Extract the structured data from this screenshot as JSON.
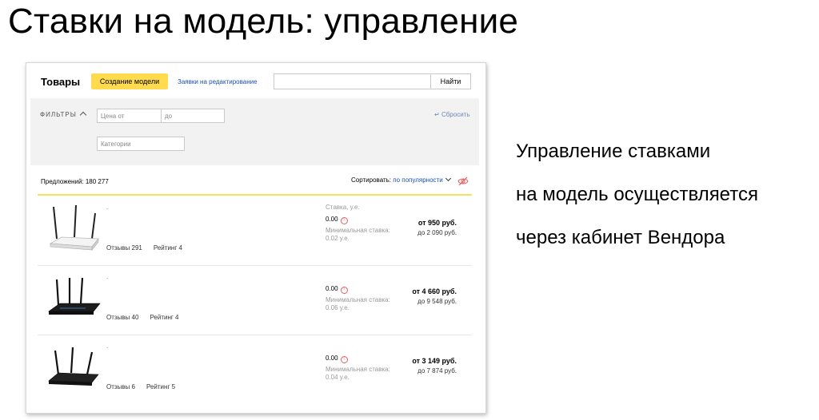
{
  "slide": {
    "title": "Ставки на модель: управление",
    "description": [
      "Управление ставками",
      "на модель осуществляется",
      "через кабинет Вендора"
    ]
  },
  "header": {
    "title": "Товары",
    "create_button": "Создание модели",
    "requests_link": "Заявки на редактирование",
    "search_value": "",
    "find_button": "Найти"
  },
  "filters": {
    "label": "ФИЛЬТРЫ",
    "price_from_placeholder": "Цена от",
    "price_to_placeholder": "до",
    "category_placeholder": "Категории",
    "reset_label": "Сбросить"
  },
  "results": {
    "offers_label": "Предложений: 180 277",
    "sort_label": "Сортировать:",
    "sort_value": "по популярности"
  },
  "products": [
    {
      "name": ".",
      "reviews": "Отзывы 291",
      "rating": "Рейтинг 4",
      "rate_header": "Ставка, у.е.",
      "rate": "0.00",
      "min_rate_label": "Минимальная ставка:",
      "min_rate_value": "0.02 у.е.",
      "price_from": "от 950 руб.",
      "price_to": "до 2 090 руб."
    },
    {
      "name": ".",
      "reviews": "Отзывы 40",
      "rating": "Рейтинг 4",
      "rate": "0.00",
      "min_rate_label": "Минимальная ставка:",
      "min_rate_value": "0.06 у.е.",
      "price_from": "от 4 660 руб.",
      "price_to": "до 9 548 руб."
    },
    {
      "name": ".",
      "reviews": "Отзывы 6",
      "rating": "Рейтинг 5",
      "rate": "0.00",
      "min_rate_label": "Минимальная ставка:",
      "min_rate_value": "0.04 у.е.",
      "price_from": "от 3 149 руб.",
      "price_to": "до 7 874 руб."
    }
  ],
  "colors": {
    "accent_yellow": "#ffdb4d",
    "link_blue": "#1a4fb4",
    "warning_red": "#e06060"
  },
  "icons": {
    "reset": "return-arrow-icon",
    "sort": "chevron-down-icon",
    "hide": "eye-slash-icon",
    "filters": "chevron-up-icon",
    "warning": "warning-icon",
    "product_image": "router-icon"
  }
}
